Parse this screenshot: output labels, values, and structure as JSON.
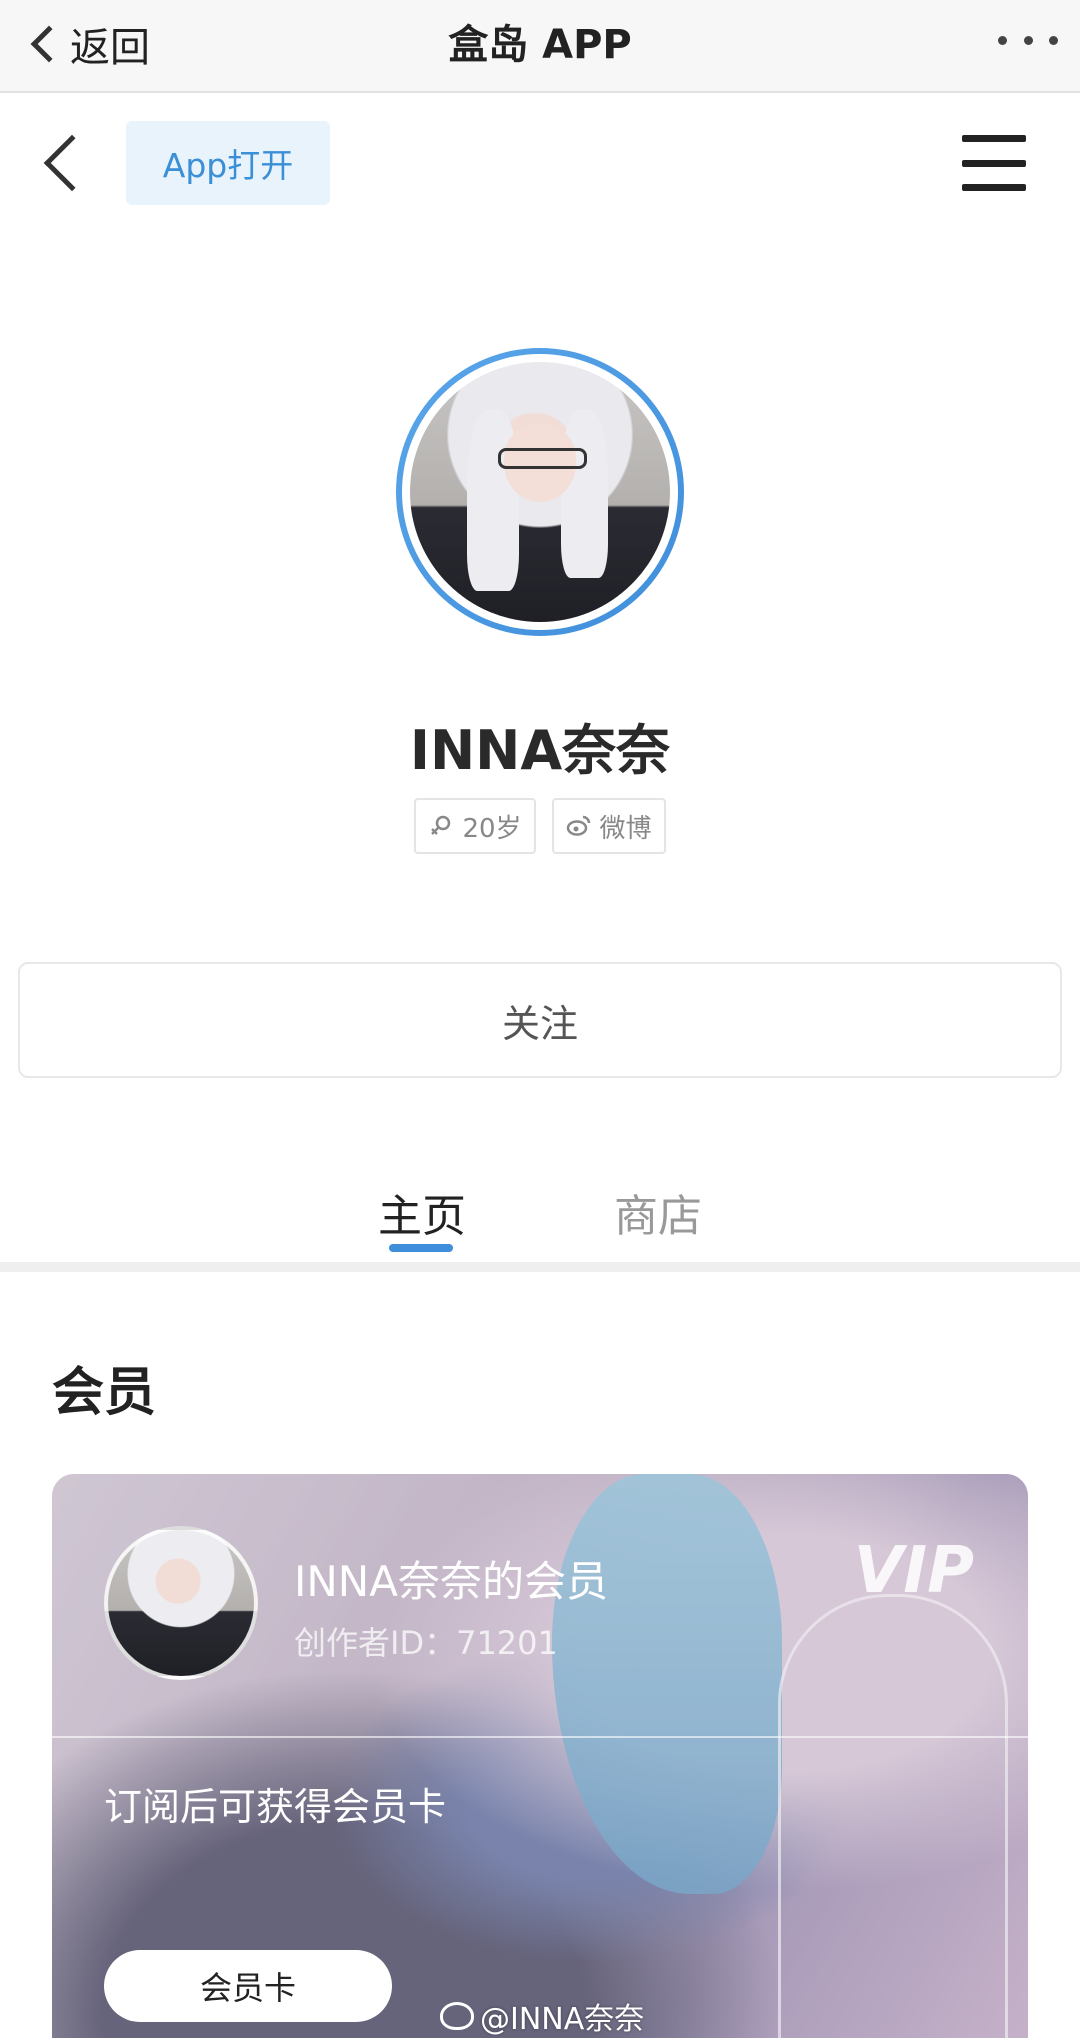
{
  "topbar": {
    "back_label": "返回",
    "title": "盒岛 APP"
  },
  "nav": {
    "app_open_label": "App打开"
  },
  "profile": {
    "name": "INNA奈奈",
    "tags": [
      {
        "icon": "female-icon",
        "label": "20岁"
      },
      {
        "icon": "weibo-icon",
        "label": "微博"
      }
    ],
    "follow_label": "关注"
  },
  "tabs": [
    {
      "label": "主页",
      "active": true
    },
    {
      "label": "商店",
      "active": false
    }
  ],
  "colors": {
    "accent": "#3f8edb",
    "app_open_bg": "#e8f3fc"
  },
  "member_section": {
    "title": "会员",
    "card": {
      "title": "INNA奈奈的会员",
      "creator_id": "创作者ID：71201",
      "badge": "VIP",
      "subtitle": "订阅后可获得会员卡",
      "button_label": "会员卡"
    }
  },
  "watermark": "@INNA奈奈"
}
